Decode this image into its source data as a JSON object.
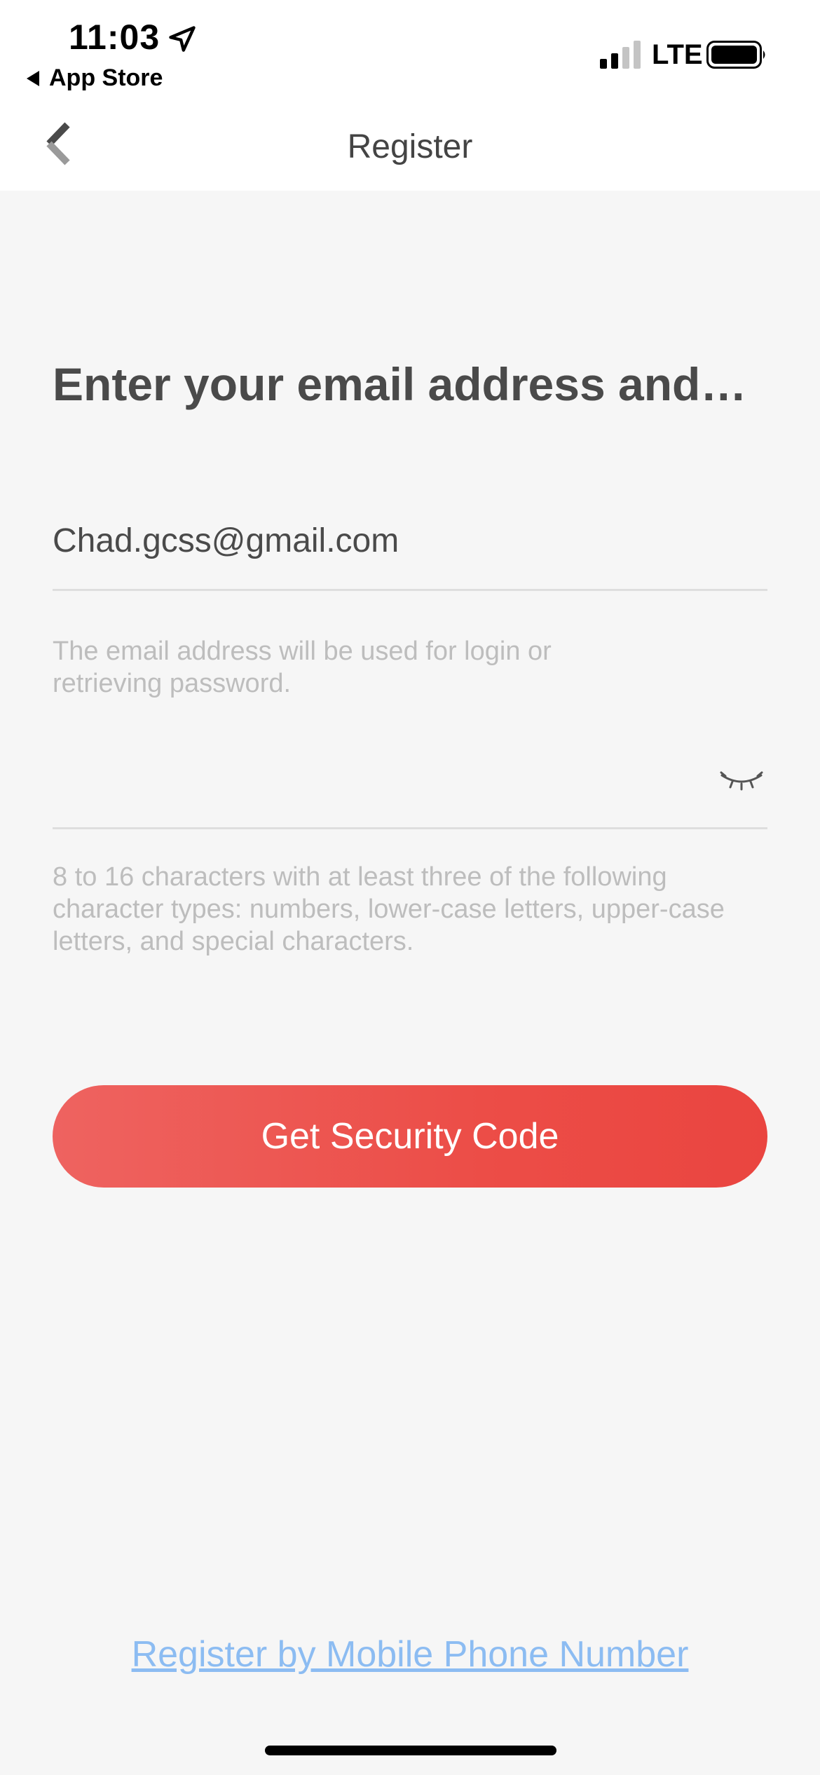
{
  "status_bar": {
    "time": "11:03",
    "back_app_label": "App Store",
    "network": "LTE"
  },
  "nav": {
    "title": "Register"
  },
  "form": {
    "heading": "Enter your email address and…",
    "email_value": "Chad.gcss@gmail.com",
    "email_hint": "The email address will be used for login or retrieving password.",
    "password_value": "",
    "password_hint": "8 to 16 characters with at least three of the following character types: numbers, lower-case letters, upper-case letters, and special characters.",
    "submit_label": "Get Security Code",
    "alt_link_label": "Register by Mobile Phone Number"
  },
  "colors": {
    "accent": "#ec4d47",
    "link": "#8cbcf2",
    "hint": "#bdbdbd"
  },
  "icons": [
    "location-arrow-icon",
    "signal-bars-icon",
    "battery-icon",
    "back-chevron-icon",
    "closed-eye-icon"
  ]
}
